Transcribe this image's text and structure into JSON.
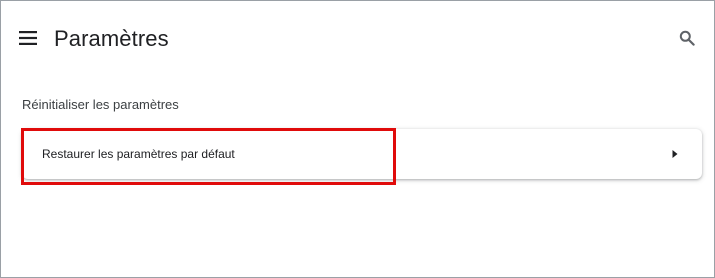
{
  "header": {
    "menu_icon": "hamburger-menu-icon",
    "title": "Paramètres",
    "search_icon": "search-icon"
  },
  "section": {
    "title": "Réinitialiser les paramètres",
    "items": [
      {
        "label": "Restaurer les paramètres par défaut",
        "icon": "arrow-right-icon"
      }
    ]
  },
  "annotation": {
    "highlight_color": "#e00b0b"
  }
}
